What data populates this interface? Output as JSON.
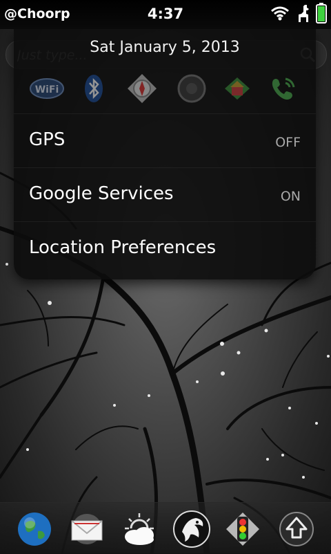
{
  "status_bar": {
    "carrier": "@Choorp",
    "time": "4:37",
    "icons": [
      "wifi-icon",
      "llama-icon",
      "battery-icon"
    ],
    "battery_color": "#3fd13f"
  },
  "search": {
    "placeholder": "Just type..."
  },
  "panel": {
    "date": "Sat January 5, 2013",
    "quick_toggles": [
      "wifi-icon",
      "bluetooth-icon",
      "compass-icon",
      "speaker-icon",
      "home-icon",
      "phone-icon"
    ],
    "items": [
      {
        "label": "GPS",
        "value": "OFF"
      },
      {
        "label": "Google Services",
        "value": "ON"
      },
      {
        "label": "Location Preferences",
        "value": ""
      }
    ]
  },
  "dock": {
    "apps": [
      "globe-icon",
      "email-icon",
      "weather-icon",
      "eagle-icon",
      "traffic-light-icon",
      "launcher-up-icon"
    ]
  }
}
